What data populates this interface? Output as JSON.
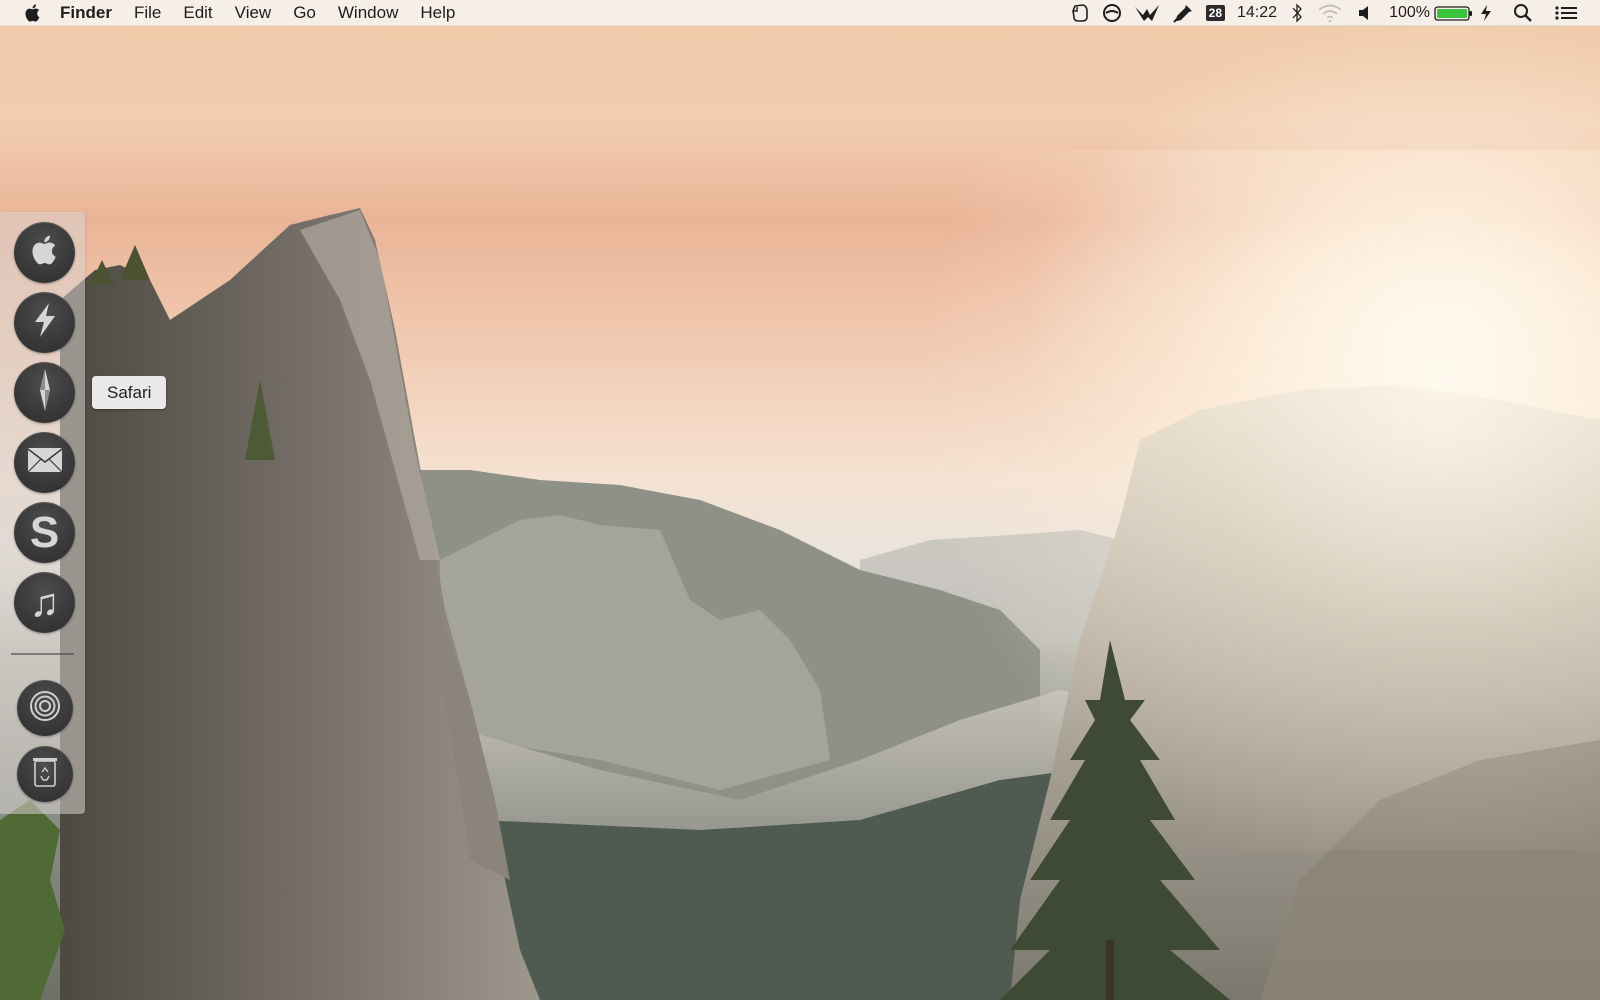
{
  "menubar": {
    "apple_menu_icon": "apple-icon",
    "app_name": "Finder",
    "menus": [
      "File",
      "Edit",
      "View",
      "Go",
      "Window",
      "Help"
    ],
    "status": {
      "extra_icons": [
        "evernote-icon",
        "circle-slash-icon",
        "crane-icon",
        "dropper-icon"
      ],
      "calendar_day": "28",
      "clock": "14:22",
      "bluetooth_icon": "bluetooth-icon",
      "wifi_icon": "wifi-icon",
      "volume_icon": "volume-icon",
      "battery_percent": "100%",
      "battery_level": 1.0,
      "charging_icon": "charging-bolt-icon",
      "spotlight_icon": "search-icon",
      "notifications_icon": "list-icon"
    }
  },
  "dock": {
    "apps": [
      {
        "name": "Finder",
        "icon": "apple-icon"
      },
      {
        "name": "Launchpad",
        "icon": "lightning-icon"
      },
      {
        "name": "Safari",
        "icon": "compass-icon"
      },
      {
        "name": "Mail",
        "icon": "envelope-icon"
      },
      {
        "name": "Skype",
        "icon": "s-letter-icon",
        "glyph": "S"
      },
      {
        "name": "iTunes",
        "icon": "music-note-icon",
        "glyph": "♫"
      }
    ],
    "stack_icon": "concentric-circles-icon",
    "trash_icon": "trash-icon",
    "tooltip": "Safari"
  },
  "colors": {
    "menubar_bg": "#f6f2ee",
    "dock_icon_bg": "#3a3a3a",
    "battery_green": "#39c43c"
  }
}
